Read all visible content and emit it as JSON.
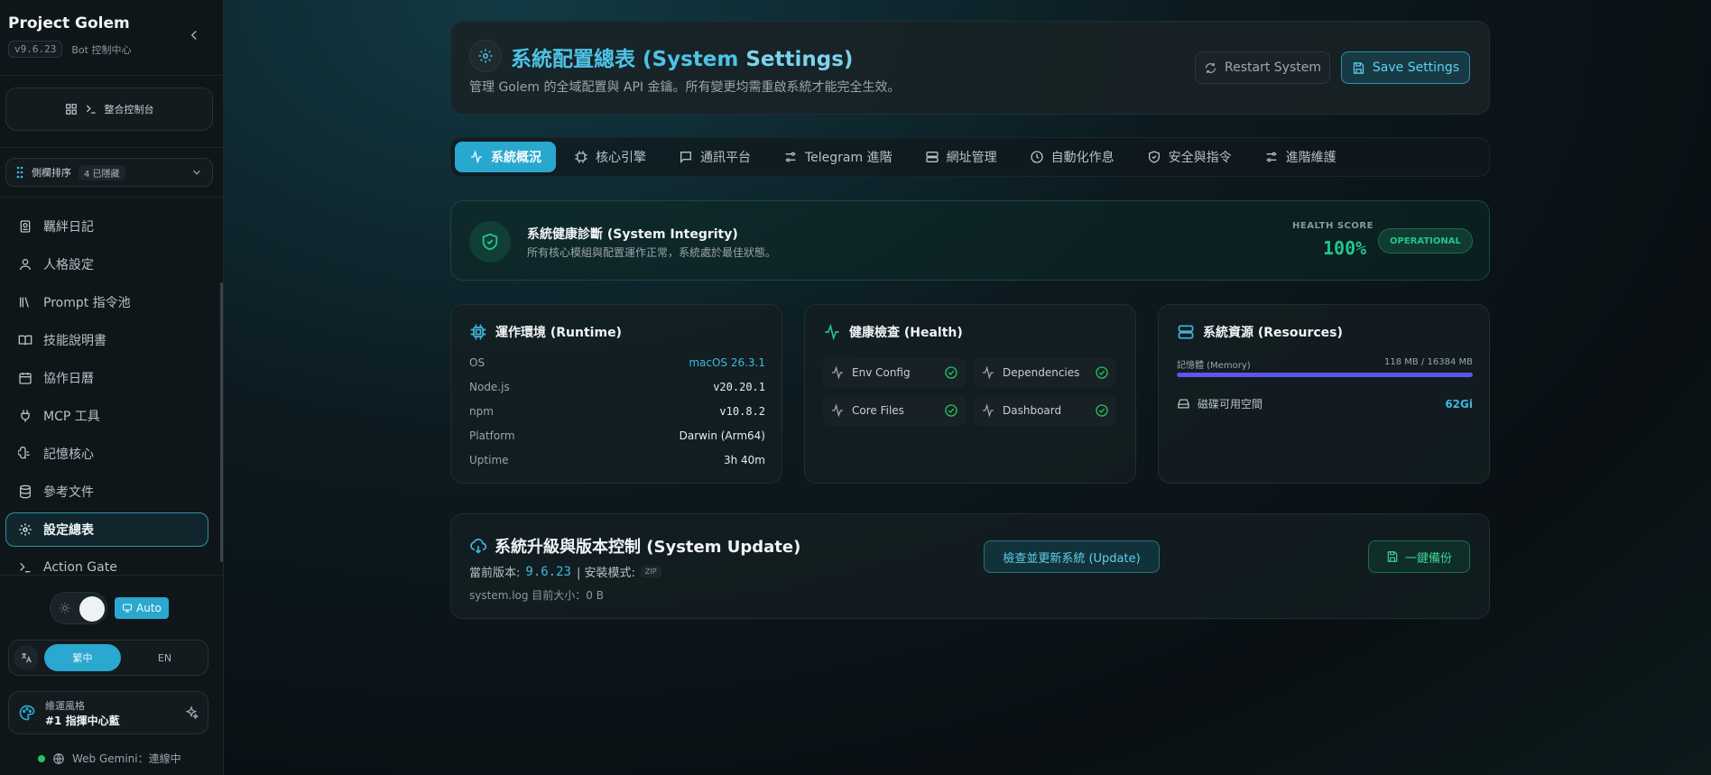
{
  "sidebar": {
    "title": "Project Golem",
    "version": "v9.6.23",
    "subtitle": "Bot 控制中心",
    "console_label": "整合控制台",
    "order_label": "側欄排序",
    "order_badge": "4 已隱藏",
    "items": [
      {
        "label": "羈絆日記",
        "icon": "journal-icon"
      },
      {
        "label": "人格設定",
        "icon": "user-icon"
      },
      {
        "label": "Prompt 指令池",
        "icon": "library-icon"
      },
      {
        "label": "技能說明書",
        "icon": "book-icon"
      },
      {
        "label": "協作日曆",
        "icon": "calendar-icon"
      },
      {
        "label": "MCP 工具",
        "icon": "plug-icon"
      },
      {
        "label": "記憶核心",
        "icon": "brain-icon"
      },
      {
        "label": "參考文件",
        "icon": "database-icon"
      },
      {
        "label": "設定總表",
        "icon": "gear-icon",
        "active": true
      },
      {
        "label": "Action Gate",
        "icon": "terminal-icon"
      }
    ],
    "theme_auto": "Auto",
    "lang_zh": "繁中",
    "lang_en": "EN",
    "style_label": "維運風格",
    "style_value": "#1 指揮中心藍",
    "status": "Web Gemini：連線中"
  },
  "header": {
    "title_main": "系統配置總表 (System ",
    "title_hl": "Settings)",
    "description": "管理 Golem 的全域配置與 API 金鑰。所有變更均需重啟系統才能完全生效。",
    "restart_label": "Restart System",
    "save_label": "Save Settings"
  },
  "tabs": [
    {
      "label": "系統概況",
      "icon": "activity-icon",
      "active": true
    },
    {
      "label": "核心引擎",
      "icon": "cpu-icon"
    },
    {
      "label": "通訊平台",
      "icon": "chat-icon"
    },
    {
      "label": "Telegram 進階",
      "icon": "sliders-icon"
    },
    {
      "label": "網址管理",
      "icon": "server-icon"
    },
    {
      "label": "自動化作息",
      "icon": "clock-icon"
    },
    {
      "label": "安全與指令",
      "icon": "shield-icon"
    },
    {
      "label": "進階維護",
      "icon": "settings-sliders-icon"
    }
  ],
  "health": {
    "title": "系統健康診斷 (System Integrity)",
    "description": "所有核心模組與配置運作正常，系統處於最佳狀態。",
    "score_label": "HEALTH SCORE",
    "score": "100%",
    "status": "OPERATIONAL"
  },
  "runtime": {
    "title": "運作環境 (Runtime)",
    "rows": [
      {
        "key": "OS",
        "value": "macOS 26.3.1"
      },
      {
        "key": "Node.js",
        "value": "v20.20.1"
      },
      {
        "key": "npm",
        "value": "v10.8.2"
      },
      {
        "key": "Platform",
        "value": "Darwin (Arm64)"
      },
      {
        "key": "Uptime",
        "value": "3h 40m"
      }
    ]
  },
  "healthcheck": {
    "title": "健康檢查 (Health)",
    "items": [
      "Env Config",
      "Dependencies",
      "Core Files",
      "Dashboard"
    ]
  },
  "resources": {
    "title": "系統資源 (Resources)",
    "memory_label": "記憶體 (Memory)",
    "memory_value": "118 MB / 16384 MB",
    "memory_fill_fraction": 1.0,
    "disk_label": "磁碟可用空間",
    "disk_value": "62Gi"
  },
  "update": {
    "title": "系統升級與版本控制 (System Update)",
    "current_label": "當前版本:",
    "current_version": "9.6.23",
    "install_label": "| 安裝模式:",
    "install_mode": "ZIP",
    "log_label": "system.log 目前大小：0 B",
    "check_label": "檢查並更新系統 (Update)",
    "backup_label": "一鍵備份"
  },
  "colors": {
    "accent": "#29a8cf",
    "success": "#22c58c",
    "memory_bar": "#5b57e8"
  }
}
